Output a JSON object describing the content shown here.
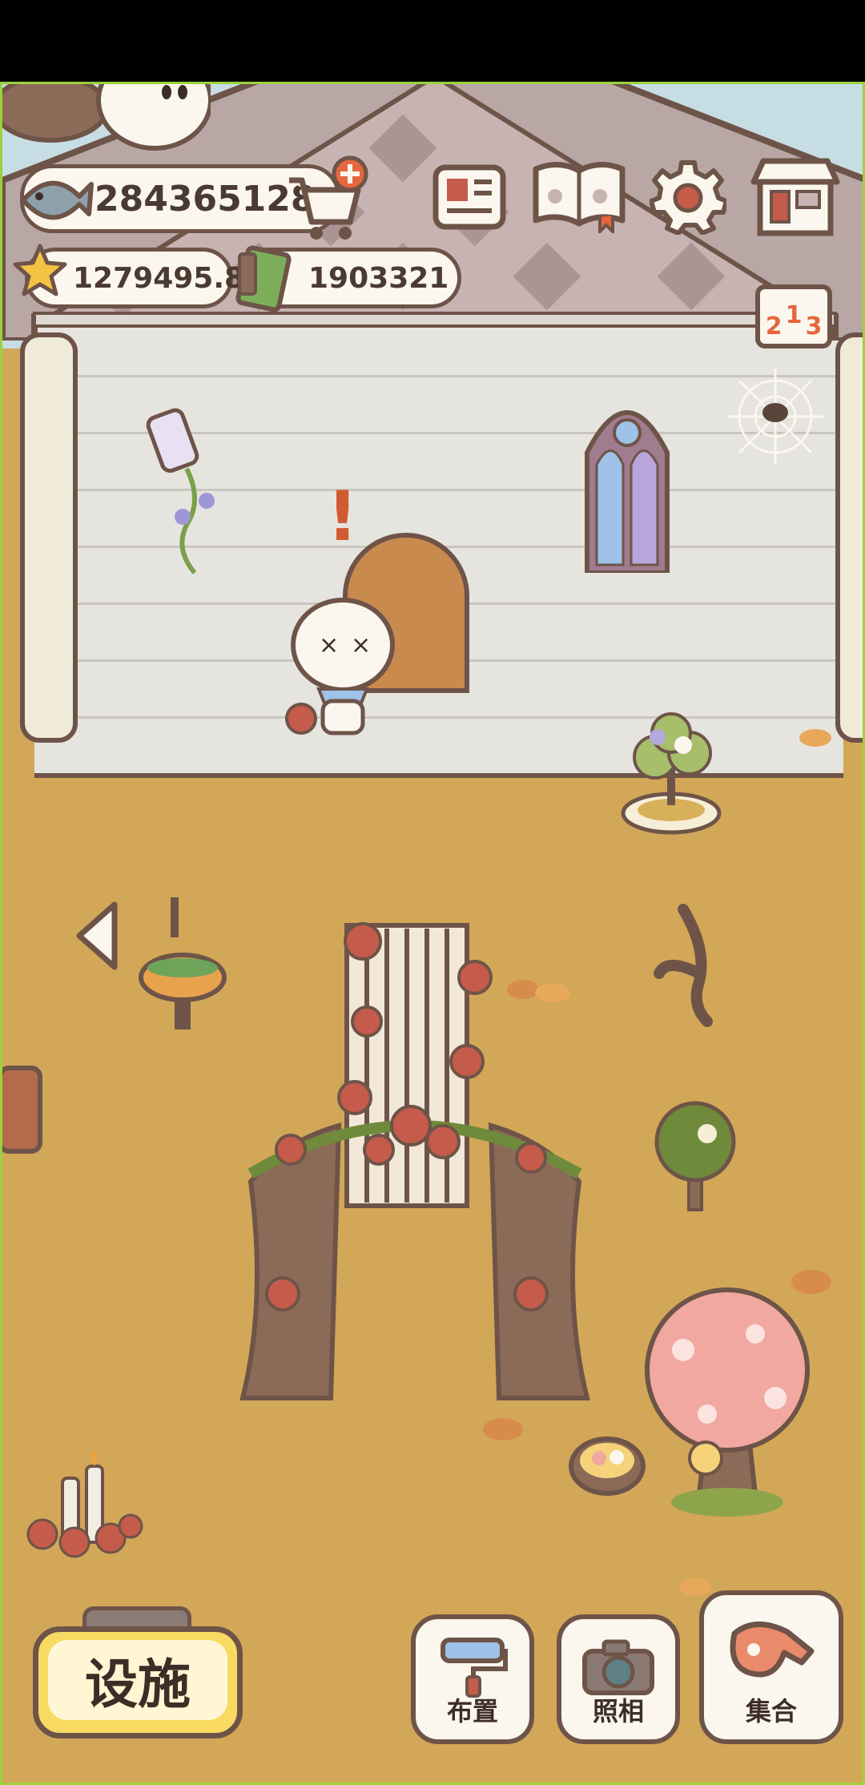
{
  "currency": {
    "fish": "284365128",
    "stars": "1279495.8",
    "bills": "1903321"
  },
  "hud_icons": [
    "fish-icon",
    "cart-add-icon",
    "news-icon",
    "paw-book-icon",
    "settings-gear-icon",
    "shop-icon",
    "leaderboard-podium-icon"
  ],
  "buttons": {
    "facility": "设施",
    "layout": "布置",
    "photo": "照相",
    "gather": "集合"
  },
  "podium_numbers": [
    "2",
    "1",
    "3"
  ],
  "alert_mark": "!",
  "colors": {
    "outline": "#6e5448",
    "ground": "#d2a758",
    "wall": "#e6e4df",
    "button_fill": "#fbf7ef",
    "facility_fill": "#f8da63",
    "frame_green": "#9bd23c"
  }
}
